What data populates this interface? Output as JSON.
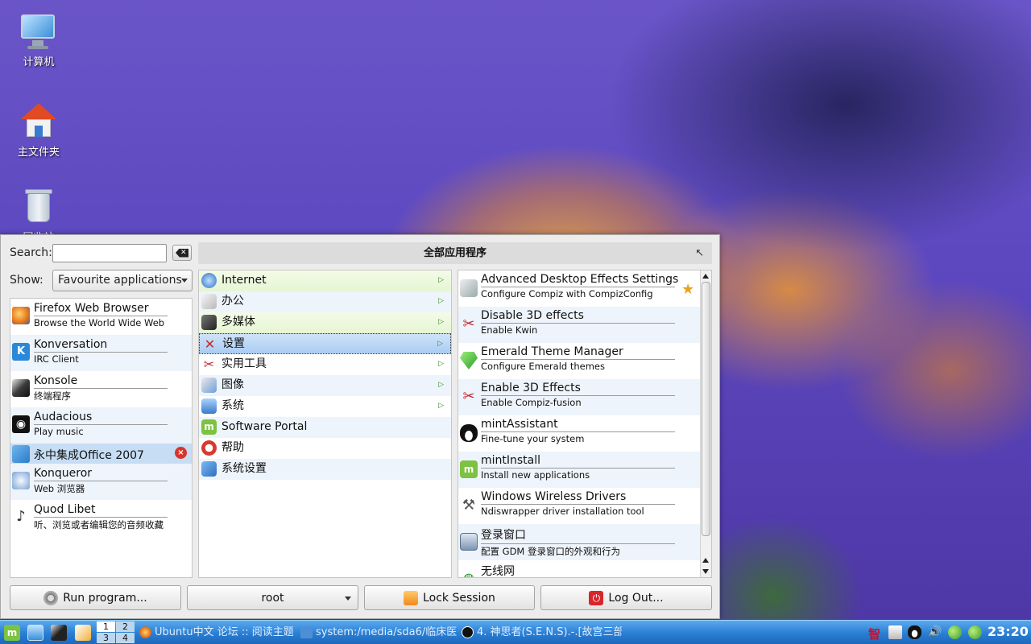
{
  "desktop": {
    "icons": [
      {
        "label": "计算机"
      },
      {
        "label": "主文件夹"
      },
      {
        "label": "回收站"
      }
    ]
  },
  "menu": {
    "search_label": "Search:",
    "search_value": "",
    "show_label": "Show:",
    "show_value": "Favourite applications",
    "header_title": "全部应用程序",
    "favourites": [
      {
        "name": "Firefox Web Browser",
        "desc": "Browse the World Wide Web"
      },
      {
        "name": "Konversation",
        "desc": "IRC Client"
      },
      {
        "name": "Konsole",
        "desc": "终端程序"
      },
      {
        "name": "Audacious",
        "desc": "Play music"
      },
      {
        "name": "永中集成Office 2007",
        "desc": ""
      },
      {
        "name": "Konqueror",
        "desc": "Web 浏览器"
      },
      {
        "name": "Quod Libet",
        "desc": "听、浏览或者编辑您的音频收藏"
      }
    ],
    "categories": [
      {
        "label": "Internet"
      },
      {
        "label": "办公"
      },
      {
        "label": "多媒体"
      },
      {
        "label": "设置"
      },
      {
        "label": "实用工具"
      },
      {
        "label": "图像"
      },
      {
        "label": "系统"
      },
      {
        "label": "Software Portal"
      },
      {
        "label": "帮助"
      },
      {
        "label": "系统设置"
      }
    ],
    "apps": [
      {
        "name": "Advanced Desktop Effects Settings",
        "desc": "Configure Compiz with CompizConfig"
      },
      {
        "name": "Disable 3D effects",
        "desc": "Enable Kwin"
      },
      {
        "name": "Emerald Theme Manager",
        "desc": "Configure Emerald themes"
      },
      {
        "name": "Enable 3D Effects",
        "desc": "Enable Compiz-fusion"
      },
      {
        "name": "mintAssistant",
        "desc": "Fine-tune your system"
      },
      {
        "name": "mintInstall",
        "desc": "Install new applications"
      },
      {
        "name": "Windows Wireless Drivers",
        "desc": "Ndiswrapper driver installation tool"
      },
      {
        "name": "登录窗口",
        "desc": "配置 GDM 登录窗口的外观和行为"
      },
      {
        "name": "无线网",
        "desc": ""
      }
    ],
    "buttons": {
      "run": "Run program...",
      "user": "root",
      "lock": "Lock Session",
      "logout": "Log Out..."
    }
  },
  "taskbar": {
    "pager": [
      "1",
      "2",
      "3",
      "4"
    ],
    "tasks": [
      {
        "label": "Ubuntu中文 论坛 :: 阅读主题"
      },
      {
        "label": "system:/media/sda6/临床医"
      },
      {
        "label": "4. 神思者(S.E.N.S).-.[故宫三部"
      }
    ],
    "tray_text": "智",
    "clock": "23:20"
  },
  "colors": {
    "accent_blue": "#2a7ed3",
    "selection": "#a9ccf2",
    "category_green": "#e6f5d3"
  }
}
